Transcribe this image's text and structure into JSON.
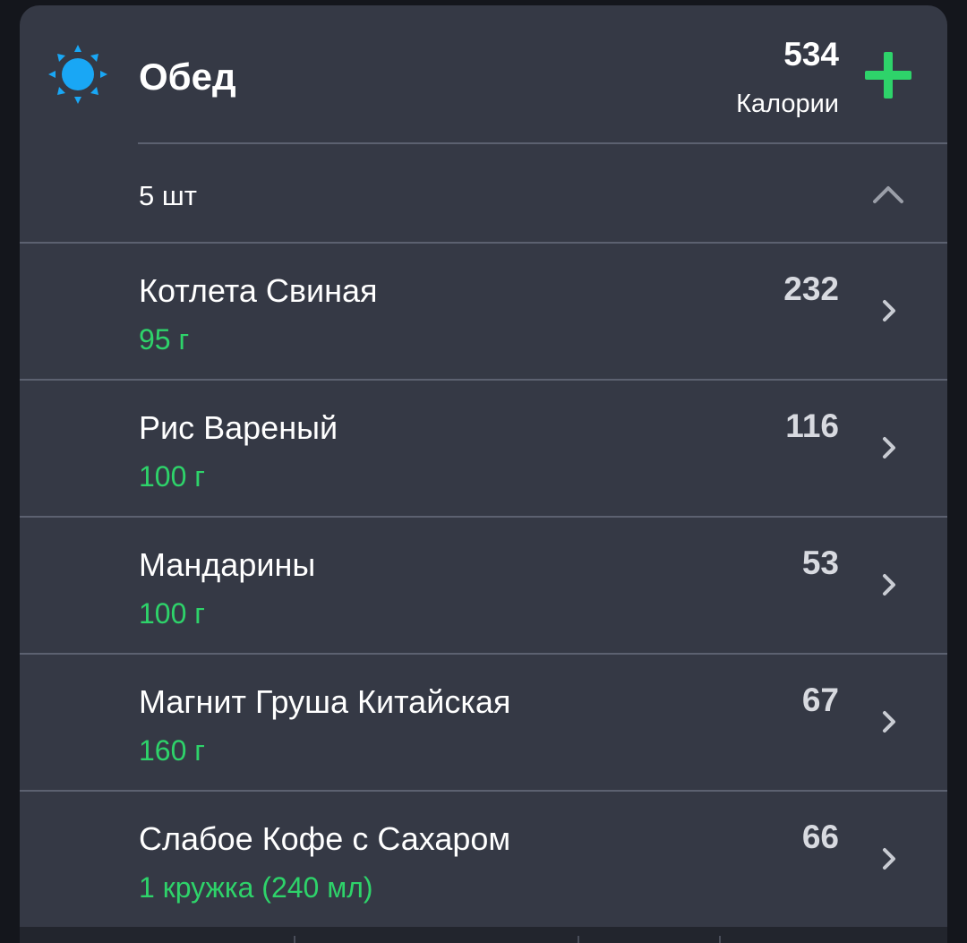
{
  "meal": {
    "title": "Обед",
    "icon": "sun-icon",
    "total_calories": "534",
    "calories_label": "Калории",
    "item_count": "5 шт"
  },
  "items": [
    {
      "name": "Котлета Свиная",
      "portion": "95 г",
      "calories": "232"
    },
    {
      "name": "Рис Вареный",
      "portion": "100 г",
      "calories": "116"
    },
    {
      "name": "Мандарины",
      "portion": "100 г",
      "calories": "53"
    },
    {
      "name": "Магнит Груша Китайская",
      "portion": "160 г",
      "calories": "67"
    },
    {
      "name": "Слабое Кофе с Сахаром",
      "portion": "1 кружка (240 мл)",
      "calories": "66"
    }
  ],
  "colors": {
    "background": "#14161c",
    "card": "#353945",
    "accent_green": "#2ed36a",
    "sun_blue": "#19a7f5",
    "divider": "#5c6170"
  }
}
